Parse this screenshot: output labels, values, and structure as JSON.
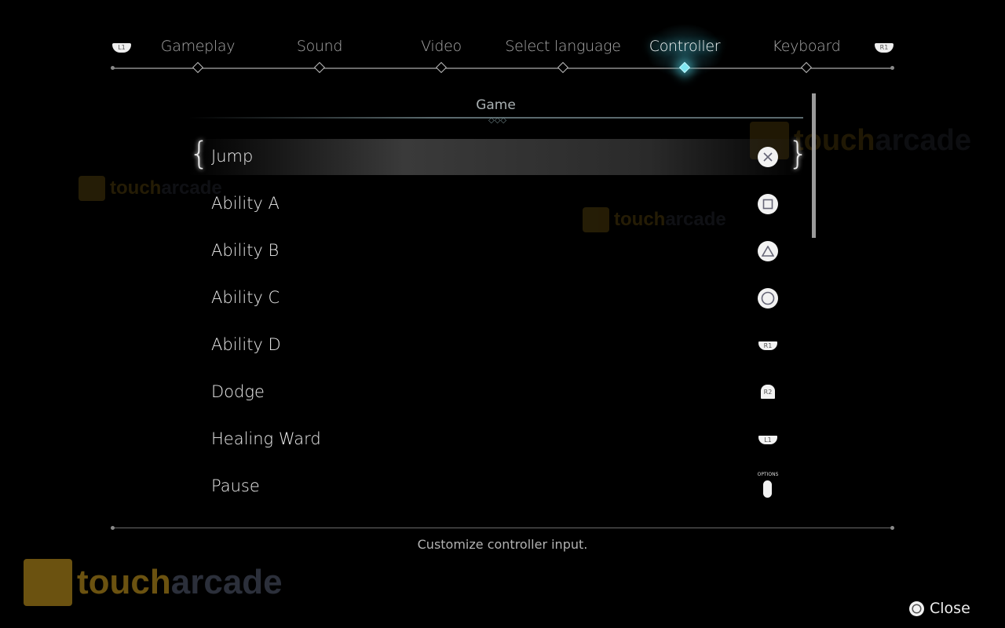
{
  "nav": {
    "left_bumper": "L1",
    "right_bumper": "R1",
    "tabs": [
      {
        "label": "Gameplay",
        "active": false
      },
      {
        "label": "Sound",
        "active": false
      },
      {
        "label": "Video",
        "active": false
      },
      {
        "label": "Select language",
        "active": false
      },
      {
        "label": "Controller",
        "active": true
      },
      {
        "label": "Keyboard",
        "active": false
      }
    ],
    "accent_color": "#7fe6f0"
  },
  "section": {
    "title": "Game"
  },
  "bindings": [
    {
      "action": "Jump",
      "button": "cross-icon",
      "selected": true
    },
    {
      "action": "Ability A",
      "button": "square-icon"
    },
    {
      "action": "Ability B",
      "button": "triangle-icon"
    },
    {
      "action": "Ability C",
      "button": "circle-icon"
    },
    {
      "action": "Ability D",
      "button": "R1"
    },
    {
      "action": "Dodge",
      "button": "R2"
    },
    {
      "action": "Healing Ward",
      "button": "L1"
    },
    {
      "action": "Pause",
      "button": "OPTIONS"
    }
  ],
  "footer": {
    "hint": "Customize controller input.",
    "close_label": "Close",
    "close_icon": "circle-icon"
  },
  "watermark": {
    "text_a": "touch",
    "text_b": "arcade"
  }
}
